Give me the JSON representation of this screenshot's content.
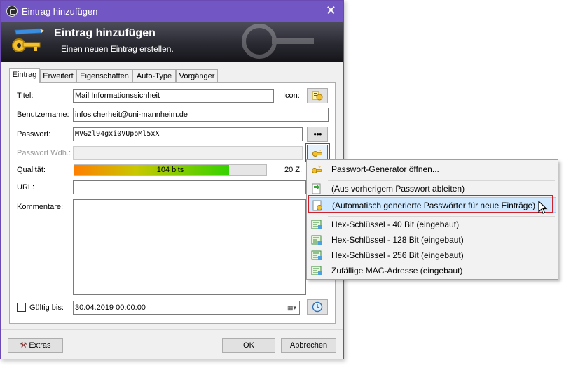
{
  "window": {
    "title": "Eintrag hinzufügen",
    "close_glyph": "✕",
    "banner_title": "Eintrag hinzufügen",
    "banner_subtitle": "Einen neuen Eintrag erstellen."
  },
  "tabs": [
    {
      "label": "Eintrag",
      "active": true
    },
    {
      "label": "Erweitert"
    },
    {
      "label": "Eigenschaften"
    },
    {
      "label": "Auto-Type"
    },
    {
      "label": "Vorgänger"
    }
  ],
  "form": {
    "title_label": "Titel:",
    "title_value": "Mail Informationssichheit",
    "icon_label": "Icon:",
    "username_label": "Benutzername:",
    "username_value": "infosicherheit@uni-mannheim.de",
    "password_label": "Passwort:",
    "password_value": "MVGzl94gxi0VUpoMl5xX",
    "show_password_glyph": "●●●",
    "repeat_label": "Passwort Wdh.:",
    "quality_label": "Qualität:",
    "quality_text": "104 bits",
    "quality_fraction": 0.805,
    "quality_chars": "20 Z.",
    "url_label": "URL:",
    "comments_label": "Kommentare:",
    "expires_label": "Gültig bis:",
    "expires_value": "30.04.2019 00:00:00",
    "expires_checked": false
  },
  "buttons": {
    "extras": "Extras",
    "ok": "OK",
    "cancel": "Abbrechen"
  },
  "menu": {
    "items": [
      {
        "label": "Passwort-Generator öffnen...",
        "icon": "key-generator-icon"
      },
      {
        "label": "(Aus vorherigem Passwort ableiten)",
        "icon": "derive-icon"
      },
      {
        "label": "(Automatisch generierte Passwörter für neue Einträge)",
        "icon": "auto-generate-icon",
        "highlighted": true
      },
      {
        "label": "Hex-Schlüssel - 40 Bit (eingebaut)",
        "icon": "hex-key-icon"
      },
      {
        "label": "Hex-Schlüssel - 128 Bit (eingebaut)",
        "icon": "hex-key-icon"
      },
      {
        "label": "Hex-Schlüssel - 256 Bit (eingebaut)",
        "icon": "hex-key-icon"
      },
      {
        "label": "Zufällige MAC-Adresse (eingebaut)",
        "icon": "mac-address-icon"
      }
    ]
  },
  "colors": {
    "titlebar": "#7257c4",
    "highlight": "#cde8ff",
    "annotation_red": "#d0212b"
  }
}
